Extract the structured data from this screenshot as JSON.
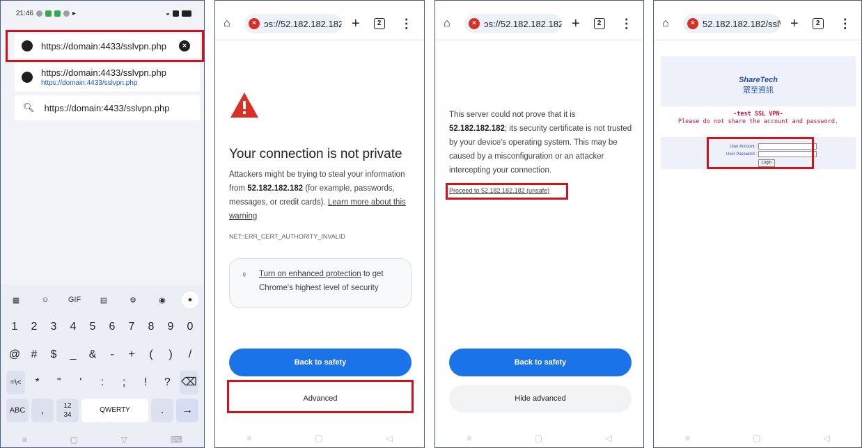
{
  "panel1": {
    "status_time": "21:46",
    "omnibox_text": "https://domain:4433/sslvpn.php",
    "suggestions": [
      {
        "main": "https://domain:4433/sslvpn.php",
        "sub": "https://domain:4433/sslvpn.php"
      },
      {
        "main": "https://domain:4433/sslvpn.php"
      }
    ],
    "keyboard": {
      "tools": [
        "GIF"
      ],
      "row1": [
        "1",
        "2",
        "3",
        "4",
        "5",
        "6",
        "7",
        "8",
        "9",
        "0"
      ],
      "row2": [
        "@",
        "#",
        "$",
        "_",
        "&",
        "-",
        "+",
        "(",
        ")",
        "/"
      ],
      "row3": [
        "=\\<",
        "*",
        "\"",
        "'",
        ":",
        ";",
        "!",
        "?",
        "⌫"
      ],
      "row4": [
        "ABC",
        ",",
        "12\n34",
        "QWERTY",
        ".",
        "→"
      ]
    }
  },
  "panel2": {
    "url": "ɔs://52.182.182.182",
    "tab_count": "2",
    "title": "Your connection is not private",
    "body_pre": "Attackers might be trying to steal your information from ",
    "body_host": "52.182.182.182",
    "body_post": " (for example, passwords, messages, or credit cards). ",
    "learn_more": "Learn more about this warning",
    "error_code": "NET::ERR_CERT_AUTHORITY_INVALID",
    "enhanced_link": "Turn on enhanced protection",
    "enhanced_rest": " to get Chrome's highest level of security",
    "back_button": "Back to safety",
    "advanced_button": "Advanced"
  },
  "panel3": {
    "url": "ɔs://52.182.182.182",
    "tab_count": "2",
    "body_pre": "This server could not prove that it is ",
    "body_host": "52.182.182.182",
    "body_post": "; its security certificate is not trusted by your device's operating system. This may be caused by a misconfiguration or an attacker intercepting your connection.",
    "proceed_link": "Proceed to 52.182.182.182 (unsafe)",
    "back_button": "Back to safety",
    "hide_button": "Hide advanced"
  },
  "panel4": {
    "url": "52.182.182.182/ssl\\",
    "tab_count": "2",
    "logo_brand": "ShareTech",
    "logo_cn": "眾至資訊",
    "vpn_title": "-test SSL VPN-",
    "vpn_notice": "Please do not share the account and password.",
    "user_account_label": "User Account :",
    "user_password_label": "User Password :",
    "login_button": "Login"
  },
  "colors": {
    "highlight_red": "#d0121b",
    "chrome_blue": "#1a73e8",
    "warning_red": "#d93025"
  }
}
